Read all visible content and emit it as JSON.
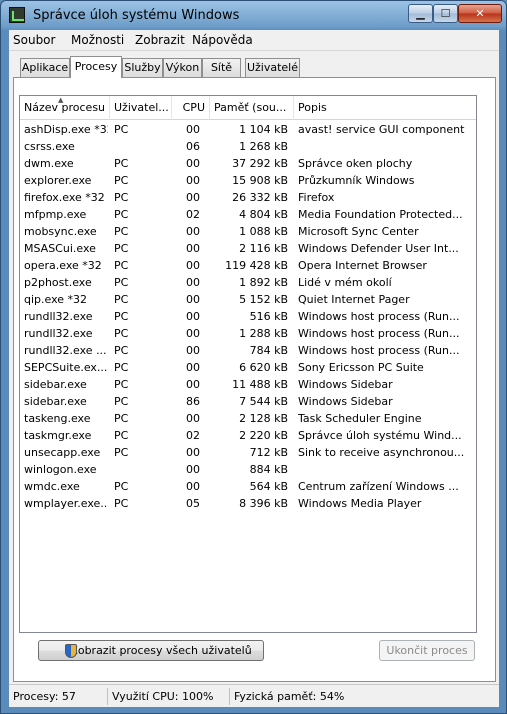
{
  "window": {
    "title": "Správce úloh systému Windows"
  },
  "menu": [
    "Soubor",
    "Možnosti",
    "Zobrazit",
    "Nápověda"
  ],
  "tabs": [
    "Aplikace",
    "Procesy",
    "Služby",
    "Výkon",
    "Sítě",
    "Uživatelé"
  ],
  "active_tab": "Procesy",
  "columns": [
    "Název procesu",
    "Uživatel...",
    "CPU",
    "Paměť (sou...",
    "Popis"
  ],
  "processes": [
    {
      "name": "ashDisp.exe *32",
      "user": "PC",
      "cpu": "00",
      "mem": "1 104 kB",
      "desc": "avast! service GUI component"
    },
    {
      "name": "csrss.exe",
      "user": "",
      "cpu": "06",
      "mem": "1 268 kB",
      "desc": ""
    },
    {
      "name": "dwm.exe",
      "user": "PC",
      "cpu": "00",
      "mem": "37 292 kB",
      "desc": "Správce oken plochy"
    },
    {
      "name": "explorer.exe",
      "user": "PC",
      "cpu": "00",
      "mem": "15 908 kB",
      "desc": "Průzkumník Windows"
    },
    {
      "name": "firefox.exe *32",
      "user": "PC",
      "cpu": "00",
      "mem": "26 332 kB",
      "desc": "Firefox"
    },
    {
      "name": "mfpmp.exe",
      "user": "PC",
      "cpu": "02",
      "mem": "4 804 kB",
      "desc": "Media Foundation Protected..."
    },
    {
      "name": "mobsync.exe",
      "user": "PC",
      "cpu": "00",
      "mem": "1 088 kB",
      "desc": "Microsoft Sync Center"
    },
    {
      "name": "MSASCui.exe",
      "user": "PC",
      "cpu": "00",
      "mem": "2 116 kB",
      "desc": "Windows Defender User Int..."
    },
    {
      "name": "opera.exe *32",
      "user": "PC",
      "cpu": "00",
      "mem": "119 428 kB",
      "desc": "Opera Internet Browser"
    },
    {
      "name": "p2phost.exe",
      "user": "PC",
      "cpu": "00",
      "mem": "1 892 kB",
      "desc": "Lidé v mém okolí"
    },
    {
      "name": "qip.exe *32",
      "user": "PC",
      "cpu": "00",
      "mem": "5 152 kB",
      "desc": "Quiet Internet Pager"
    },
    {
      "name": "rundll32.exe",
      "user": "PC",
      "cpu": "00",
      "mem": "516 kB",
      "desc": "Windows host process (Run..."
    },
    {
      "name": "rundll32.exe",
      "user": "PC",
      "cpu": "00",
      "mem": "1 288 kB",
      "desc": "Windows host process (Run..."
    },
    {
      "name": "rundll32.exe ...",
      "user": "PC",
      "cpu": "00",
      "mem": "784 kB",
      "desc": "Windows host process (Run..."
    },
    {
      "name": "SEPCSuite.ex...",
      "user": "PC",
      "cpu": "00",
      "mem": "6 620 kB",
      "desc": "Sony Ericsson PC Suite"
    },
    {
      "name": "sidebar.exe",
      "user": "PC",
      "cpu": "00",
      "mem": "11 488 kB",
      "desc": "Windows Sidebar"
    },
    {
      "name": "sidebar.exe",
      "user": "PC",
      "cpu": "86",
      "mem": "7 544 kB",
      "desc": "Windows Sidebar"
    },
    {
      "name": "taskeng.exe",
      "user": "PC",
      "cpu": "00",
      "mem": "2 128 kB",
      "desc": "Task Scheduler Engine"
    },
    {
      "name": "taskmgr.exe",
      "user": "PC",
      "cpu": "02",
      "mem": "2 220 kB",
      "desc": "Správce úloh systému Wind..."
    },
    {
      "name": "unsecapp.exe",
      "user": "PC",
      "cpu": "00",
      "mem": "712 kB",
      "desc": "Sink to receive asynchronou..."
    },
    {
      "name": "winlogon.exe",
      "user": "",
      "cpu": "00",
      "mem": "884 kB",
      "desc": ""
    },
    {
      "name": "wmdc.exe",
      "user": "PC",
      "cpu": "00",
      "mem": "564 kB",
      "desc": "Centrum zařízení Windows ..."
    },
    {
      "name": "wmplayer.exe...",
      "user": "PC",
      "cpu": "05",
      "mem": "8 396 kB",
      "desc": "Windows Media Player"
    }
  ],
  "buttons": {
    "show_all": "Zobrazit procesy všech uživatelů",
    "end_process": "Ukončit proces"
  },
  "status": {
    "processes": "Procesy: 57",
    "cpu": "Využití CPU: 100%",
    "memory": "Fyzická paměť: 54%"
  }
}
